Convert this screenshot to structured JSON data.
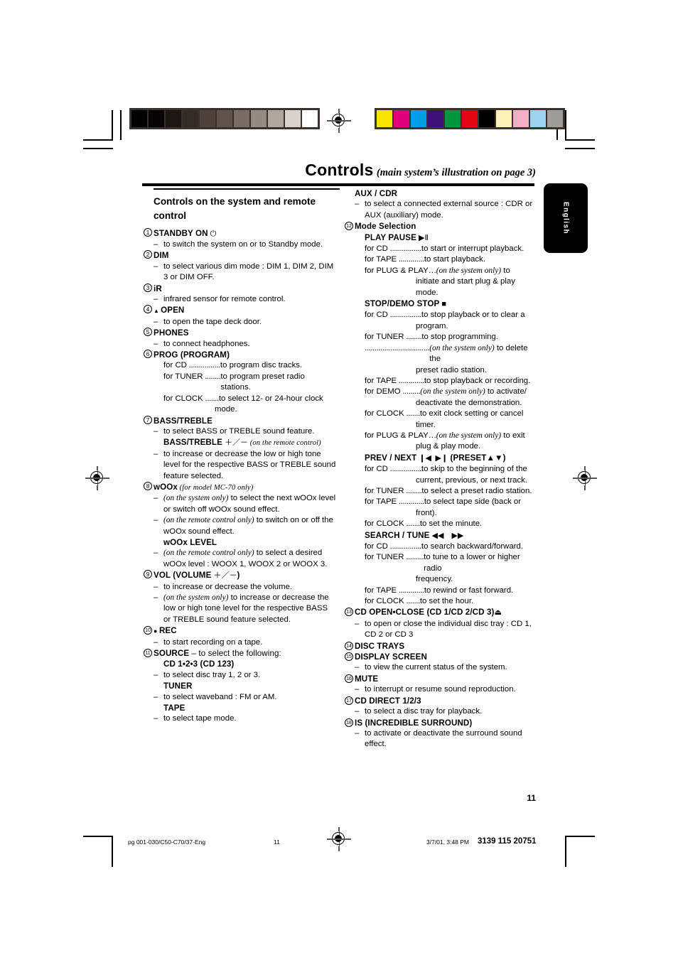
{
  "header": {
    "title_main": "Controls",
    "title_sub": "(main system’s illustration on page 3)",
    "language_tab": "English"
  },
  "footer": {
    "page_number": "11",
    "file_ref": "pg 001-030/C50-C70/37-Eng",
    "folio": "11",
    "timestamp": "3/7/01, 3:48 PM",
    "doc_number": "3139 115 20751"
  },
  "calibration": {
    "grayscale": [
      "#000000",
      "#050303",
      "#1c1714",
      "#332b26",
      "#4c423b",
      "#5e544d",
      "#776d66",
      "#948a84",
      "#b0a6a0",
      "#d8d2cc",
      "#ffffff"
    ],
    "colors": [
      "#f5e400",
      "#e2007f",
      "#009fe3",
      "#3b1178",
      "#009640",
      "#e30613",
      "#000000",
      "#fcf3b8",
      "#f4aec6",
      "#9bd3f0",
      "#9d9d9c"
    ]
  },
  "left_column": {
    "section_title": "Controls on the system and remote control",
    "items": [
      {
        "num": "1",
        "heading": "STANDBY ON",
        "heading_glyph": "⏻",
        "lines": [
          {
            "type": "dash",
            "text": "to switch the system on or to Standby mode."
          }
        ]
      },
      {
        "num": "2",
        "heading": "DIM",
        "lines": [
          {
            "type": "dash",
            "text": "to select various dim mode : DIM 1, DIM 2, DIM 3 or DIM OFF."
          }
        ]
      },
      {
        "num": "3",
        "heading": "iR",
        "lines": [
          {
            "type": "dash",
            "text": "infrared sensor for remote control."
          }
        ]
      },
      {
        "num": "4",
        "heading": "OPEN",
        "heading_pre_glyph": "▲",
        "lines": [
          {
            "type": "dash",
            "text": "to open the tape deck door."
          }
        ]
      },
      {
        "num": "5",
        "heading": "PHONES",
        "lines": [
          {
            "type": "dash",
            "text": "to connect headphones."
          }
        ]
      },
      {
        "num": "6",
        "heading": "PROG (PROGRAM)",
        "lines": [
          {
            "type": "for",
            "label": "for CD",
            "dots": " ................ ",
            "text": "to program disc tracks."
          },
          {
            "type": "for",
            "label": "for TUNER",
            "dots": " ........ ",
            "text": "to program preset radio stations."
          },
          {
            "type": "for",
            "label": "for CLOCK",
            "dots": " ....... ",
            "text": "to select 12- or 24-hour clock"
          },
          {
            "type": "cont",
            "text": "mode."
          }
        ]
      },
      {
        "num": "7",
        "heading": "BASS/TREBLE",
        "lines": [
          {
            "type": "dash",
            "text": "to select BASS or TREBLE sound feature."
          },
          {
            "type": "subhead",
            "text": "BASS/TREBLE",
            "glyph": "＋／－",
            "note": "(on the remote control)"
          },
          {
            "type": "dash",
            "text": "to increase or decrease the low or high tone level for the respective BASS or TREBLE sound feature selected."
          }
        ]
      },
      {
        "num": "8",
        "heading": "wOOx",
        "heading_note": "(for model MC-70 only)",
        "lines": [
          {
            "type": "dash",
            "ital_lead": "(on the system only)",
            "text": " to select the next wOOx level or switch off wOOx sound effect."
          },
          {
            "type": "dash",
            "ital_lead": "(on the remote control only)",
            "text": " to switch on or off the wOOx sound effect."
          },
          {
            "type": "subhead",
            "text": "wOOx LEVEL"
          },
          {
            "type": "dash",
            "ital_lead": "(on the remote control only)",
            "text": " to select a desired wOOx level : WOOX 1, WOOX 2 or WOOX 3."
          }
        ]
      },
      {
        "num": "9",
        "heading": "VOL (VOLUME",
        "heading_glyph2": "＋／－",
        "heading_tail": ")",
        "lines": [
          {
            "type": "dash",
            "text": "to increase or decrease the volume."
          },
          {
            "type": "dash",
            "ital_lead": "(on the system only)",
            "text": " to increase or decrease the low or high tone level for the respective BASS or TREBLE sound feature selected."
          }
        ]
      },
      {
        "num": "10",
        "heading": "REC",
        "heading_pre_glyph": "●",
        "lines": [
          {
            "type": "dash",
            "text": "to start recording on a tape."
          }
        ]
      },
      {
        "num": "11",
        "heading": "SOURCE",
        "heading_tail_plain": " – to select the following:",
        "lines": [
          {
            "type": "subhead",
            "text": "CD 1•2•3 (CD 123)"
          },
          {
            "type": "dash",
            "text": "to select disc tray 1, 2 or 3."
          },
          {
            "type": "subhead",
            "text": "TUNER"
          },
          {
            "type": "dash",
            "text": "to select waveband : FM or AM."
          },
          {
            "type": "subhead",
            "text": "TAPE"
          },
          {
            "type": "dash",
            "text": "to select tape mode."
          }
        ]
      }
    ]
  },
  "right_column": {
    "items": [
      {
        "num": "",
        "heading": "AUX / CDR",
        "lines": [
          {
            "type": "dash",
            "text": "to select a connected external source : CDR or AUX (auxiliary) mode."
          }
        ]
      },
      {
        "num": "12",
        "heading": "Mode Selection",
        "heading_light": true,
        "lines": [
          {
            "type": "subhead",
            "text": "PLAY PAUSE",
            "glyph": "▶Ⅱ"
          },
          {
            "type": "for",
            "label": "for CD",
            "dots": " ................ ",
            "text": "to start or interrupt playback."
          },
          {
            "type": "for",
            "label": "for TAPE",
            "dots": " ............. ",
            "text": "to start playback."
          },
          {
            "type": "for",
            "label": "for PLUG & PLAY",
            "dots": "…",
            "ital_lead": "(on the system only)",
            "text": " to"
          },
          {
            "type": "cont",
            "text": "initiate and start plug & play"
          },
          {
            "type": "cont",
            "text": "mode."
          },
          {
            "type": "subhead",
            "text": "STOP/DEMO STOP",
            "glyph": "■"
          },
          {
            "type": "for",
            "label": "for CD",
            "dots": " ................ ",
            "text": "to stop playback or to clear a"
          },
          {
            "type": "cont",
            "text": "program."
          },
          {
            "type": "for",
            "label": "for TUNER",
            "dots": " ........ ",
            "text": "to stop programming."
          },
          {
            "type": "for",
            "label": "",
            "dots": " ................................. ",
            "ital_lead": "(on the system only)",
            "text": " to delete the"
          },
          {
            "type": "cont",
            "text": "preset radio station."
          },
          {
            "type": "for",
            "label": "for TAPE",
            "dots": " ............. ",
            "text": "to stop playback or recording."
          },
          {
            "type": "for",
            "label": "for DEMO",
            "dots": " ......... ",
            "ital_lead": "(on the system only)",
            "text": " to activate/"
          },
          {
            "type": "cont",
            "text": "deactivate the demonstration."
          },
          {
            "type": "for",
            "label": "for CLOCK",
            "dots": " ....... ",
            "text": "to exit clock setting or cancel"
          },
          {
            "type": "cont",
            "text": "timer."
          },
          {
            "type": "for",
            "label": "for PLUG & PLAY",
            "dots": "…",
            "ital_lead": "(on the system only)",
            "text": " to exit"
          },
          {
            "type": "cont",
            "text": "plug & play mode."
          },
          {
            "type": "subhead",
            "text": "PREV / NEXT",
            "glyph": "❙◀ ▶❙",
            "tail": "(PRESET▲▼)"
          },
          {
            "type": "for",
            "label": "for CD",
            "dots": " ................ ",
            "text": "to skip to the beginning of the"
          },
          {
            "type": "cont",
            "text": "current, previous, or next track."
          },
          {
            "type": "for",
            "label": "for TUNER",
            "dots": " ........ ",
            "text": "to select a preset radio station."
          },
          {
            "type": "for",
            "label": "for TAPE",
            "dots": " ............. ",
            "text": "to select tape side (back or"
          },
          {
            "type": "cont",
            "text": "front)."
          },
          {
            "type": "for",
            "label": "for CLOCK",
            "dots": " ....... ",
            "text": "to set the minute."
          },
          {
            "type": "subhead",
            "text": "SEARCH / TUNE",
            "glyph": "◀◀  ▶▶"
          },
          {
            "type": "for",
            "label": "for CD",
            "dots": " ................ ",
            "text": "to search backward/forward."
          },
          {
            "type": "for",
            "label": "for TUNER",
            "dots": " ......... ",
            "text": "to tune to a lower or higher radio"
          },
          {
            "type": "cont",
            "text": "frequency."
          },
          {
            "type": "for",
            "label": "for TAPE",
            "dots": " ............. ",
            "text": "to rewind or fast forward."
          },
          {
            "type": "for",
            "label": "for CLOCK",
            "dots": " ....... ",
            "text": "to set the hour."
          }
        ]
      },
      {
        "num": "13",
        "heading": "CD OPEN•CLOSE (CD 1/CD 2/CD 3)",
        "heading_post_glyph": "⏏",
        "lines": [
          {
            "type": "dash",
            "text": "to open or close the individual disc tray : CD 1, CD 2 or CD 3"
          }
        ]
      },
      {
        "num": "14",
        "heading": "DISC TRAYS",
        "lines": []
      },
      {
        "num": "15",
        "heading": "DISPLAY SCREEN",
        "lines": [
          {
            "type": "dash",
            "text": "to view the current status of the system."
          }
        ]
      },
      {
        "num": "16",
        "heading": "MUTE",
        "lines": [
          {
            "type": "dash",
            "text": "to interrupt or resume sound reproduction."
          }
        ]
      },
      {
        "num": "17",
        "heading": "CD DIRECT 1/2/3",
        "lines": [
          {
            "type": "dash",
            "text": "to select a disc tray for playback."
          }
        ]
      },
      {
        "num": "18",
        "heading": "IS (INCREDIBLE SURROUND)",
        "lines": [
          {
            "type": "dash",
            "text": "to activate or deactivate the surround sound effect."
          }
        ]
      }
    ]
  }
}
